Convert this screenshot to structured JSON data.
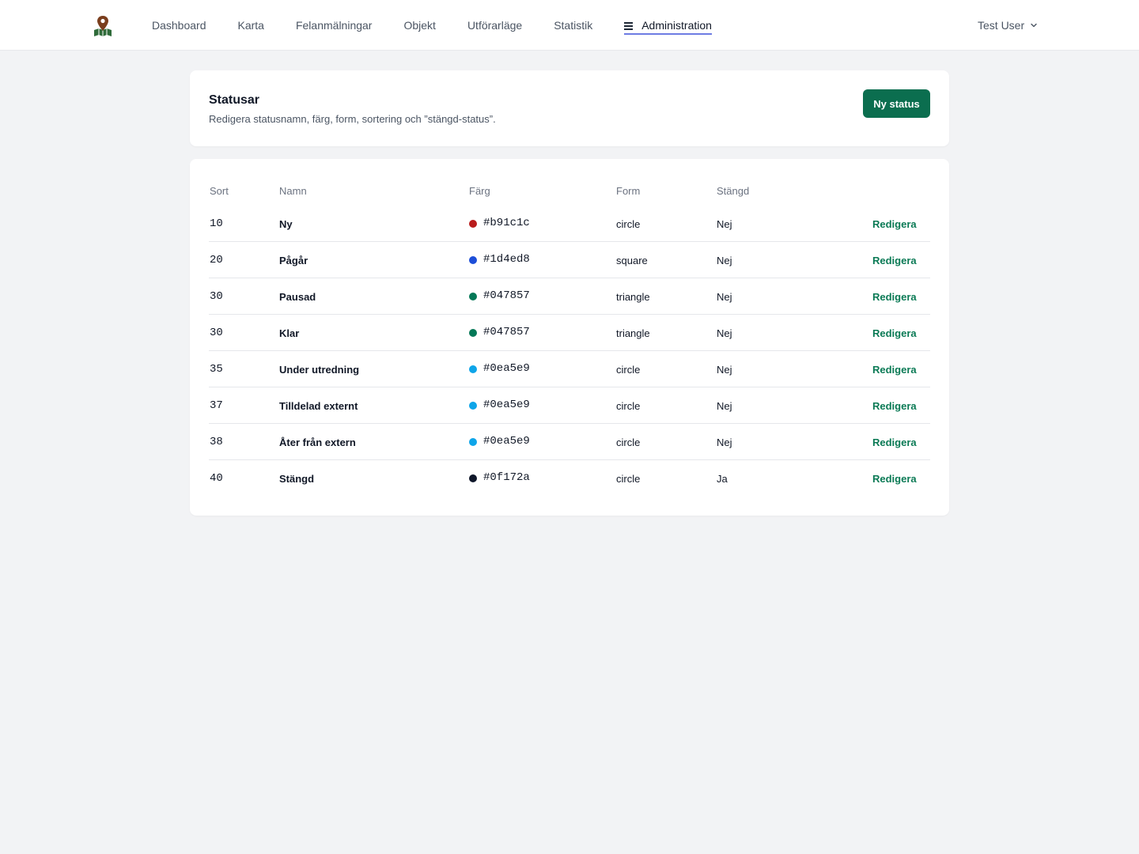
{
  "app": {
    "logo_icon": "map-pin-logo-icon",
    "nav": [
      {
        "label": "Dashboard"
      },
      {
        "label": "Karta"
      },
      {
        "label": "Felanmälningar"
      },
      {
        "label": "Objekt"
      },
      {
        "label": "Utförarläge"
      },
      {
        "label": "Statistik"
      }
    ],
    "nav_active": {
      "label": "Administration",
      "icon": "hamburger-menu-icon"
    },
    "user": {
      "name": "Test User",
      "icon": "chevron-down-icon"
    }
  },
  "page": {
    "title": "Statusar",
    "subtitle": "Redigera statusnamn, färg, form, sortering och ”stängd-status”.",
    "new_button": "Ny status"
  },
  "table": {
    "columns": {
      "sort": "Sort",
      "name": "Namn",
      "color": "Färg",
      "form": "Form",
      "closed": "Stängd"
    },
    "edit_label": "Redigera",
    "rows": [
      {
        "sort": "10",
        "name": "Ny",
        "color": "#b91c1c",
        "form": "circle",
        "closed": "Nej"
      },
      {
        "sort": "20",
        "name": "Pågår",
        "color": "#1d4ed8",
        "form": "square",
        "closed": "Nej"
      },
      {
        "sort": "30",
        "name": "Pausad",
        "color": "#047857",
        "form": "triangle",
        "closed": "Nej"
      },
      {
        "sort": "30",
        "name": "Klar",
        "color": "#047857",
        "form": "triangle",
        "closed": "Nej"
      },
      {
        "sort": "35",
        "name": "Under utredning",
        "color": "#0ea5e9",
        "form": "circle",
        "closed": "Nej"
      },
      {
        "sort": "37",
        "name": "Tilldelad externt",
        "color": "#0ea5e9",
        "form": "circle",
        "closed": "Nej"
      },
      {
        "sort": "38",
        "name": "Åter från extern",
        "color": "#0ea5e9",
        "form": "circle",
        "closed": "Nej"
      },
      {
        "sort": "40",
        "name": "Stängd",
        "color": "#0f172a",
        "form": "circle",
        "closed": "Ja"
      }
    ]
  },
  "colors": {
    "accent": "#0b6e4f",
    "link": "#0b7a55",
    "active_underline": "#6d7ce3"
  }
}
